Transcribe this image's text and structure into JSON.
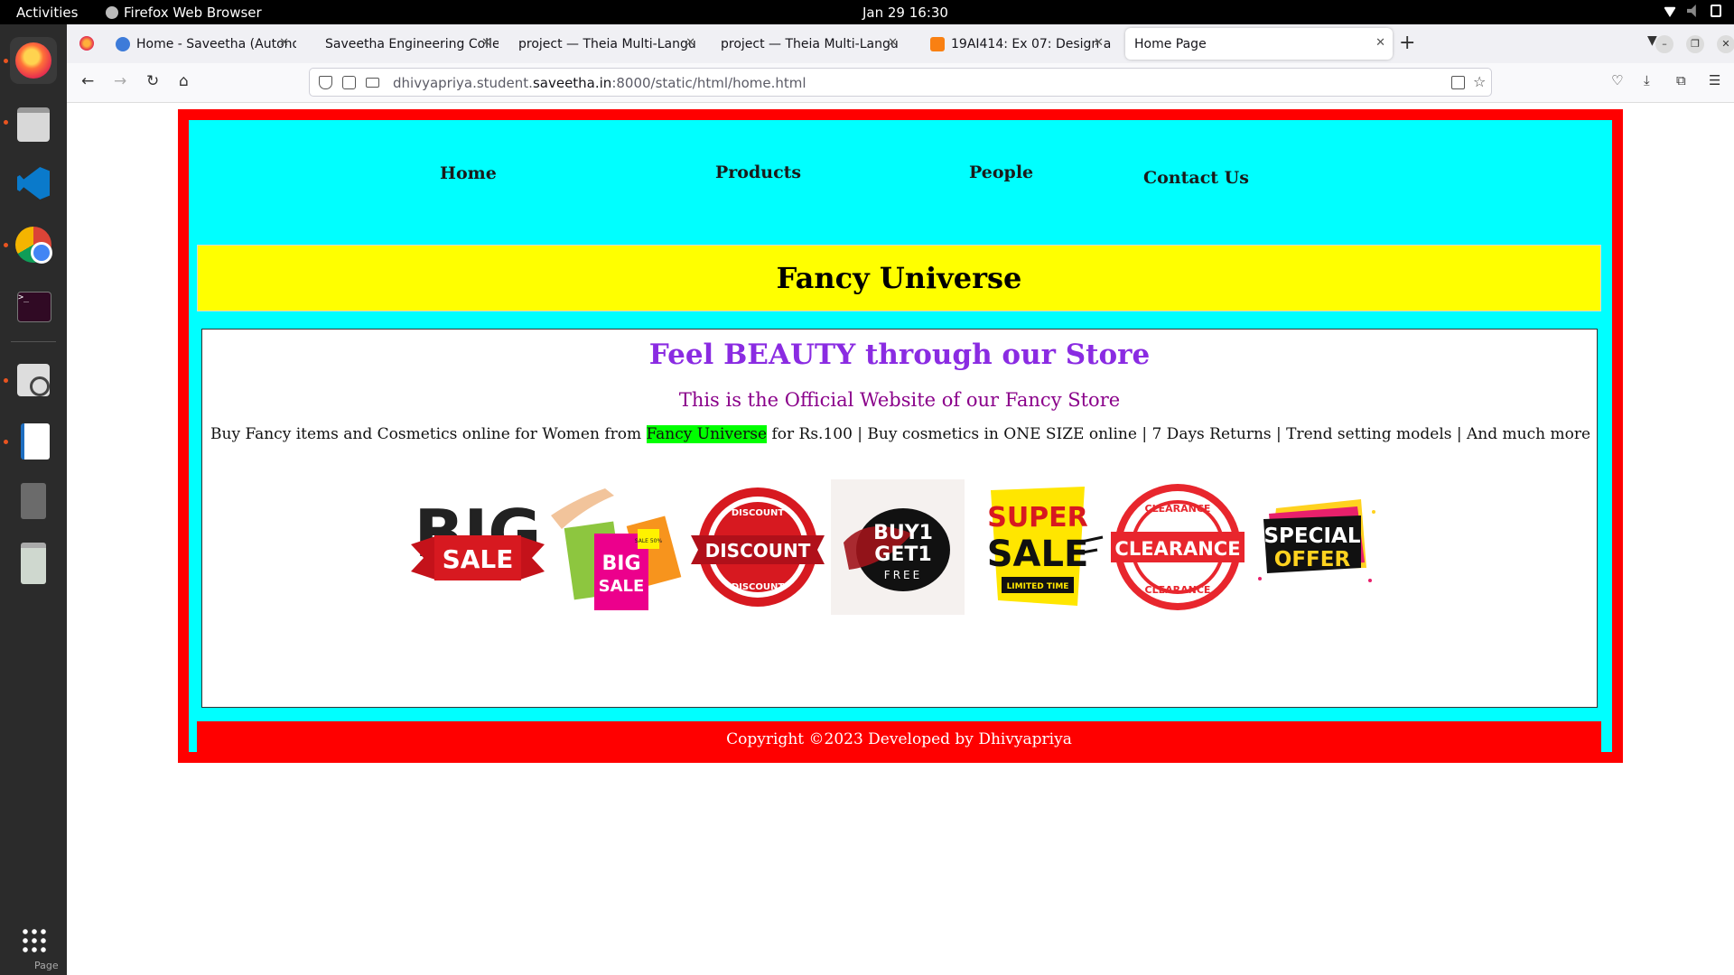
{
  "system_bar": {
    "activities": "Activities",
    "app_name": "Firefox Web Browser",
    "clock": "Jan 29  16:30",
    "tray_icons": [
      "wifi-icon",
      "volume-muted-icon",
      "battery-icon"
    ]
  },
  "dock": {
    "items": [
      "firefox",
      "files",
      "vscode",
      "chrome",
      "terminal",
      "image-viewer",
      "text-editor",
      "unknown-app",
      "trash"
    ],
    "page_label": "Page"
  },
  "browser": {
    "tabs": [
      {
        "label": "Home - Saveetha (Autono",
        "favicon": "globe-icon"
      },
      {
        "label": "Saveetha Engineering Colleg",
        "favicon": ""
      },
      {
        "label": "project — Theia Multi-Langu",
        "favicon": ""
      },
      {
        "label": "project — Theia Multi-Langu",
        "favicon": ""
      },
      {
        "label": "19AI414: Ex 07: Design a",
        "favicon": "moodle-icon"
      },
      {
        "label": "Home Page",
        "favicon": "",
        "active": true
      }
    ],
    "url_prefix": "dhivyapriya.student.",
    "url_domain": "saveetha.in",
    "url_suffix": ":8000/static/html/home.html"
  },
  "page": {
    "nav": {
      "home": "Home",
      "products": "Products",
      "people": "People",
      "contact": "Contact Us"
    },
    "banner_title": "Fancy Universe",
    "headline": "Feel BEAUTY through our Store",
    "subheadline": "This is the Official Website of our Fancy Store",
    "description_before": "Buy Fancy items and Cosmetics online for Women from ",
    "description_highlight": "Fancy Universe",
    "description_after": " for Rs.100 | Buy cosmetics in ONE SIZE online | 7 Days Returns | Trend setting models | And much more",
    "offers": [
      {
        "name": "big-sale-ribbon",
        "line1": "BIG",
        "line2": "SALE"
      },
      {
        "name": "big-sale-bags",
        "line1": "BIG",
        "line2": "SALE",
        "tag": "SALE 50%"
      },
      {
        "name": "discount-badge",
        "line1": "DISCOUNT",
        "ring": "DISCOUNT"
      },
      {
        "name": "buy1-get1-free",
        "line1": "BUY1",
        "line2": "GET1",
        "line3": "FREE"
      },
      {
        "name": "super-sale",
        "line1": "SUPER",
        "line2": "SALE",
        "line3": "LIMITED TIME"
      },
      {
        "name": "clearance-stamp",
        "line1": "CLEARANCE",
        "ring": "CLEARANCE"
      },
      {
        "name": "special-offer",
        "line1": "SPECIAL",
        "line2": "OFFER"
      }
    ],
    "footer": "Copyright ©2023 Developed by Dhivyapriya"
  },
  "colors": {
    "outer_border": "#ff0000",
    "inner_background": "#00ffff",
    "banner": "#ffff00",
    "headline": "#8a2be2",
    "subheadline": "#8a008a",
    "highlight": "#00ff00",
    "footer": "#ff0000"
  }
}
